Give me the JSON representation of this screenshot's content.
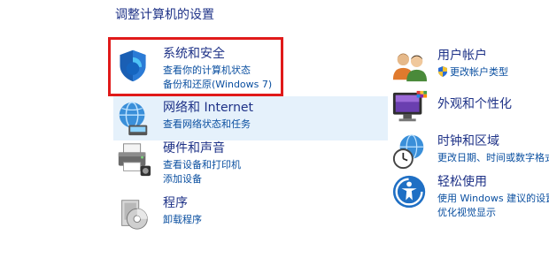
{
  "title": "调整计算机的设置",
  "left_categories": [
    {
      "name": "系统和安全",
      "links": [
        "查看你的计算机状态",
        "备份和还原(Windows 7)"
      ],
      "icon": "shield-icon"
    },
    {
      "name": "网络和 Internet",
      "links": [
        "查看网络状态和任务"
      ],
      "icon": "network-globe-icon"
    },
    {
      "name": "硬件和声音",
      "links": [
        "查看设备和打印机",
        "添加设备"
      ],
      "icon": "printer-icon"
    },
    {
      "name": "程序",
      "links": [
        "卸载程序"
      ],
      "icon": "programs-disc-icon"
    }
  ],
  "right_categories": [
    {
      "name": "用户帐户",
      "links": [
        "更改帐户类型"
      ],
      "icon": "users-icon"
    },
    {
      "name": "外观和个性化",
      "links": [],
      "icon": "monitor-palette-icon"
    },
    {
      "name": "时钟和区域",
      "links": [
        "更改日期、时间或数字格式"
      ],
      "icon": "clock-globe-icon"
    },
    {
      "name": "轻松使用",
      "links": [
        "使用 Windows 建议的设置",
        "优化视觉显示"
      ],
      "icon": "ease-of-access-icon"
    }
  ],
  "colors": {
    "heading": "#1e3287",
    "link": "#0a4fa0",
    "highlight_box": "#e01a1a",
    "hover_bg": "#e5f1fb"
  }
}
